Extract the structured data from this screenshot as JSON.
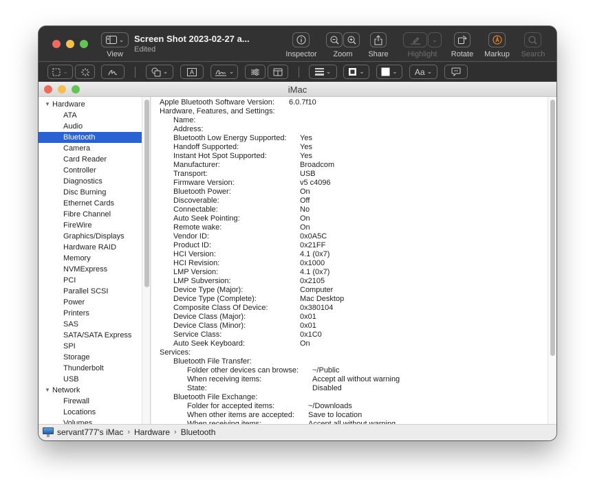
{
  "preview_window": {
    "title": "Screen Shot 2023-02-27 a...",
    "subtitle": "Edited",
    "toolbar": {
      "view_label": "View",
      "inspector_label": "Inspector",
      "zoom_label": "Zoom",
      "share_label": "Share",
      "highlight_label": "Highlight",
      "rotate_label": "Rotate",
      "markup_label": "Markup",
      "search_label": "Search"
    },
    "markup_toolbar": {
      "text_tool_glyph": "A",
      "font_glyph": "Aa"
    },
    "colors": {
      "markup_accent": "#e8832a",
      "selection_blue": "#2a62d3"
    }
  },
  "system_info_window": {
    "title": "iMac",
    "sidebar": {
      "items": [
        {
          "label": "Hardware",
          "type": "group",
          "expanded": true
        },
        {
          "label": "ATA"
        },
        {
          "label": "Audio"
        },
        {
          "label": "Bluetooth",
          "selected": true
        },
        {
          "label": "Camera"
        },
        {
          "label": "Card Reader"
        },
        {
          "label": "Controller"
        },
        {
          "label": "Diagnostics"
        },
        {
          "label": "Disc Burning"
        },
        {
          "label": "Ethernet Cards"
        },
        {
          "label": "Fibre Channel"
        },
        {
          "label": "FireWire"
        },
        {
          "label": "Graphics/Displays"
        },
        {
          "label": "Hardware RAID"
        },
        {
          "label": "Memory"
        },
        {
          "label": "NVMExpress"
        },
        {
          "label": "PCI"
        },
        {
          "label": "Parallel SCSI"
        },
        {
          "label": "Power"
        },
        {
          "label": "Printers"
        },
        {
          "label": "SAS"
        },
        {
          "label": "SATA/SATA Express"
        },
        {
          "label": "SPI"
        },
        {
          "label": "Storage"
        },
        {
          "label": "Thunderbolt"
        },
        {
          "label": "USB"
        },
        {
          "label": "Network",
          "type": "group",
          "expanded": true
        },
        {
          "label": "Firewall"
        },
        {
          "label": "Locations"
        },
        {
          "label": "Volumes"
        }
      ]
    },
    "content": {
      "rows": [
        {
          "indent": 0,
          "key": "Apple Bluetooth Software Version:",
          "value": "6.0.7f10",
          "vcol": "inline"
        },
        {
          "indent": 0,
          "key": "Hardware, Features, and Settings:",
          "value": ""
        },
        {
          "indent": 1,
          "key": "Name:",
          "value": ""
        },
        {
          "indent": 1,
          "key": "Address:",
          "value": ""
        },
        {
          "indent": 1,
          "key": "Bluetooth Low Energy Supported:",
          "value": "Yes"
        },
        {
          "indent": 1,
          "key": "Handoff Supported:",
          "value": "Yes"
        },
        {
          "indent": 1,
          "key": "Instant Hot Spot Supported:",
          "value": "Yes"
        },
        {
          "indent": 1,
          "key": "Manufacturer:",
          "value": "Broadcom"
        },
        {
          "indent": 1,
          "key": "Transport:",
          "value": "USB"
        },
        {
          "indent": 1,
          "key": "Firmware Version:",
          "value": "v5 c4096"
        },
        {
          "indent": 1,
          "key": "Bluetooth Power:",
          "value": "On"
        },
        {
          "indent": 1,
          "key": "Discoverable:",
          "value": "Off"
        },
        {
          "indent": 1,
          "key": "Connectable:",
          "value": "No"
        },
        {
          "indent": 1,
          "key": "Auto Seek Pointing:",
          "value": "On"
        },
        {
          "indent": 1,
          "key": "Remote wake:",
          "value": "On"
        },
        {
          "indent": 1,
          "key": "Vendor ID:",
          "value": "0x0A5C"
        },
        {
          "indent": 1,
          "key": "Product ID:",
          "value": "0x21FF"
        },
        {
          "indent": 1,
          "key": "HCI Version:",
          "value": "4.1 (0x7)"
        },
        {
          "indent": 1,
          "key": "HCI Revision:",
          "value": "0x1000"
        },
        {
          "indent": 1,
          "key": "LMP Version:",
          "value": "4.1 (0x7)"
        },
        {
          "indent": 1,
          "key": "LMP Subversion:",
          "value": "0x2105"
        },
        {
          "indent": 1,
          "key": "Device Type (Major):",
          "value": "Computer"
        },
        {
          "indent": 1,
          "key": "Device Type (Complete):",
          "value": "Mac Desktop"
        },
        {
          "indent": 1,
          "key": "Composite Class Of Device:",
          "value": "0x380104"
        },
        {
          "indent": 1,
          "key": "Device Class (Major):",
          "value": "0x01"
        },
        {
          "indent": 1,
          "key": "Device Class (Minor):",
          "value": "0x01"
        },
        {
          "indent": 1,
          "key": "Service Class:",
          "value": "0x1C0"
        },
        {
          "indent": 1,
          "key": "Auto Seek Keyboard:",
          "value": "On"
        },
        {
          "indent": 0,
          "key": "Services:",
          "value": ""
        },
        {
          "indent": 1,
          "key": "Bluetooth File Transfer:",
          "value": ""
        },
        {
          "indent": 2,
          "key": "Folder other devices can browse:",
          "value": "~/Public",
          "vcol": "ft1"
        },
        {
          "indent": 2,
          "key": "When receiving items:",
          "value": "Accept all without warning",
          "vcol": "ft2"
        },
        {
          "indent": 2,
          "key": "State:",
          "value": "Disabled",
          "vcol": "ft2"
        },
        {
          "indent": 1,
          "key": "Bluetooth File Exchange:",
          "value": ""
        },
        {
          "indent": 2,
          "key": "Folder for accepted items:",
          "value": "~/Downloads",
          "vcol": "fe"
        },
        {
          "indent": 2,
          "key": "When other items are accepted:",
          "value": "Save to location",
          "vcol": "fe"
        },
        {
          "indent": 2,
          "key": "When receiving items:",
          "value": "Accept all without warning",
          "vcol": "fe"
        }
      ]
    },
    "breadcrumb": {
      "computer": "servant777's iMac",
      "separator": "›",
      "section": "Hardware",
      "item": "Bluetooth"
    }
  }
}
